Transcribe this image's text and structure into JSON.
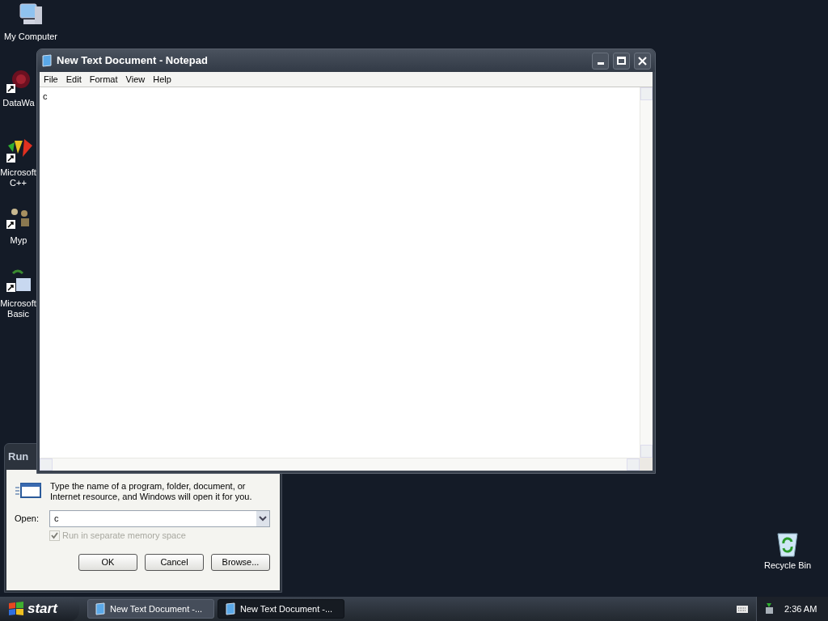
{
  "desktop_icons": [
    {
      "label": "My Computer",
      "kind": "computer"
    },
    {
      "label": "DataWa",
      "kind": "data"
    },
    {
      "label": "Microsoft\nC++",
      "kind": "cpp"
    },
    {
      "label": "Myp",
      "kind": "myp"
    },
    {
      "label": "Microsoft\nBasic",
      "kind": "basic"
    },
    {
      "label": "Recycle Bin",
      "kind": "recycle"
    }
  ],
  "notepad": {
    "title": "New Text Document - Notepad",
    "menu": [
      "File",
      "Edit",
      "Format",
      "View",
      "Help"
    ],
    "content": "c"
  },
  "run_dialog": {
    "title": "Run",
    "description": "Type the name of a program, folder, document, or Internet resource, and Windows will open it for you.",
    "open_label": "Open:",
    "open_value": "c",
    "checkbox": {
      "label": "Run in separate memory space",
      "checked": true,
      "disabled": true
    },
    "buttons": [
      "OK",
      "Cancel",
      "Browse..."
    ]
  },
  "taskbar": {
    "start_label": "start",
    "tasks": [
      {
        "label": "New Text Document -...",
        "selected": false
      },
      {
        "label": "New Text Document -...",
        "selected": true
      }
    ],
    "clock": "2:36 AM"
  }
}
